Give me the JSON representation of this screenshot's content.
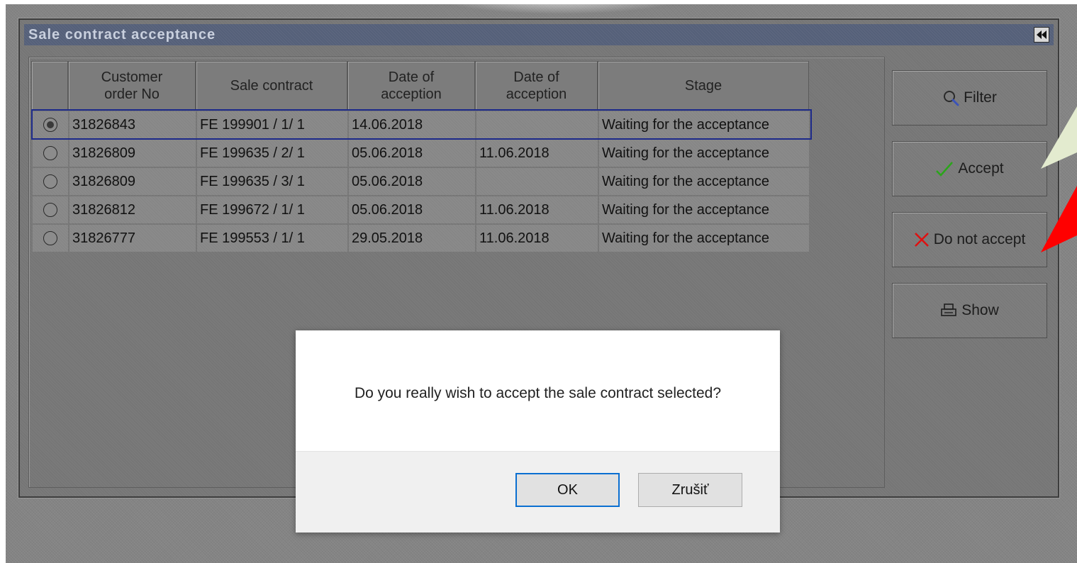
{
  "window": {
    "title": "Sale contract acceptance"
  },
  "table": {
    "columns": [
      "",
      "Customer\norder No",
      "Sale contract",
      "Date of\nacception",
      "Date of\nacception",
      "Stage"
    ],
    "rows": [
      {
        "selected": true,
        "order_no": "31826843",
        "contract": "FE 199901 / 1/ 1",
        "date1": "14.06.2018",
        "date2": "",
        "stage": "Waiting for the acceptance"
      },
      {
        "selected": false,
        "order_no": "31826809",
        "contract": "FE 199635 / 2/ 1",
        "date1": "05.06.2018",
        "date2": "11.06.2018",
        "stage": "Waiting for the acceptance"
      },
      {
        "selected": false,
        "order_no": "31826809",
        "contract": "FE 199635 / 3/ 1",
        "date1": "05.06.2018",
        "date2": "",
        "stage": "Waiting for the acceptance"
      },
      {
        "selected": false,
        "order_no": "31826812",
        "contract": "FE 199672 / 1/ 1",
        "date1": "05.06.2018",
        "date2": "11.06.2018",
        "stage": "Waiting for the acceptance"
      },
      {
        "selected": false,
        "order_no": "31826777",
        "contract": "FE 199553 / 1/ 1",
        "date1": "29.05.2018",
        "date2": "11.06.2018",
        "stage": "Waiting for the acceptance"
      }
    ]
  },
  "actions": {
    "filter": {
      "label": "Filter",
      "icon": "magnifier-icon"
    },
    "accept": {
      "label": "Accept",
      "icon": "checkmark-icon",
      "color": "#2aa51a"
    },
    "reject": {
      "label": "Do not accept",
      "icon": "x-icon",
      "color": "#e01010"
    },
    "show": {
      "label": "Show",
      "icon": "printer-icon"
    }
  },
  "annotations": {
    "accept_arrow_color": "#e3ebcf",
    "reject_arrow_color": "#ff0000"
  },
  "dialog": {
    "message": "Do you really wish to accept the sale contract selected?",
    "ok_label": "OK",
    "cancel_label": "Zrušiť"
  }
}
